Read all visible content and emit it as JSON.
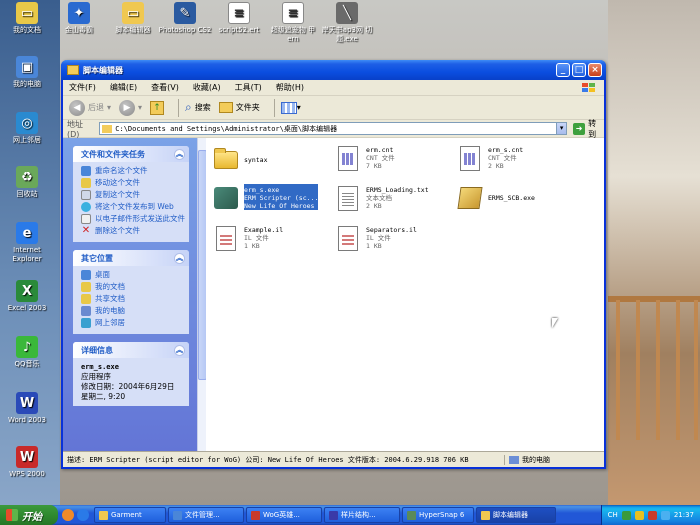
{
  "desktop": {
    "top_icons": [
      {
        "label": "我的文档",
        "color": "#e8c848"
      },
      {
        "label": "金山毒霸",
        "color": "#2a6ad0"
      },
      {
        "label": "脚本编辑器",
        "color": "#f0c850"
      },
      {
        "label": "Photoshop CS2",
        "color": "#2a5aa0"
      },
      {
        "label": "script52.ert",
        "color": "#ffffff"
      },
      {
        "label": "超级追宠物 甲 ern",
        "color": "#ffffff"
      },
      {
        "label": "岸天书ap3网 切题.exe",
        "color": "#6a6a6a"
      }
    ],
    "left_icons": [
      {
        "label": "我的电脑",
        "color": "#4a86d8"
      },
      {
        "label": "网上邻居",
        "color": "#2a8ad0"
      },
      {
        "label": "回收站",
        "color": "#6aa85a"
      },
      {
        "label": "Internet Explorer",
        "color": "#2a7ae8"
      },
      {
        "label": "Excel 2003",
        "color": "#2a8a3a"
      },
      {
        "label": "QQ音乐",
        "color": "#3ab83a"
      },
      {
        "label": "Word 2003",
        "color": "#2a4ab8"
      },
      {
        "label": "WPS 2000",
        "color": "#c82a2a"
      }
    ]
  },
  "window": {
    "title": "脚本编辑器",
    "menu": [
      "文件(F)",
      "编辑(E)",
      "查看(V)",
      "收藏(A)",
      "工具(T)",
      "帮助(H)"
    ],
    "toolbar": {
      "back": "后退",
      "search": "搜索",
      "folders": "文件夹"
    },
    "address_label": "地址(D)",
    "address_value": "C:\\Documents and Settings\\Administrator\\桌面\\脚本编辑器",
    "go_label": "转到",
    "file_tasks": {
      "title": "文件和文件夹任务",
      "items": [
        "重命名这个文件",
        "移动这个文件",
        "复制这个文件",
        "将这个文件发布到 Web",
        "以电子邮件形式发送此文件",
        "删除这个文件"
      ]
    },
    "other_places": {
      "title": "其它位置",
      "items": [
        "桌面",
        "我的文档",
        "共享文档",
        "我的电脑",
        "网上邻居"
      ]
    },
    "details": {
      "title": "详细信息",
      "name": "erm_s.exe",
      "type": "应用程序",
      "modified_label": "修改日期：",
      "modified_date": "2004年6月29日",
      "modified_time": "星期二, 9:20"
    },
    "files": [
      {
        "name": "syntax",
        "line2": "",
        "line3": "",
        "kind": "folder"
      },
      {
        "name": "erm.cnt",
        "line2": "CNT 文件",
        "line3": "7 KB",
        "kind": "cnt"
      },
      {
        "name": "erm_s.cnt",
        "line2": "CNT 文件",
        "line3": "2 KB",
        "kind": "cnt"
      },
      {
        "name": "erm_s.exe",
        "line2": "ERM Scripter (sc...",
        "line3": "New Life Of Heroes",
        "kind": "exe"
      },
      {
        "name": "ERMS_Loading.txt",
        "line2": "文本文档",
        "line3": "2 KB",
        "kind": "txt"
      },
      {
        "name": "ERMS_SCB.exe",
        "line2": "",
        "line3": "",
        "kind": "scb"
      },
      {
        "name": "Example.il",
        "line2": "IL 文件",
        "line3": "1 KB",
        "kind": "il"
      },
      {
        "name": "Separators.il",
        "line2": "IL 文件",
        "line3": "1 KB",
        "kind": "il"
      }
    ],
    "status_text": "描述: ERM Scripter (script editor for WoG) 公司: New Life Of Heroes 文件版本: 2004.6.29.918 706 KB",
    "status_zone": "我的电脑"
  },
  "taskbar": {
    "start": "开始",
    "tasks": [
      {
        "label": "Garment",
        "color": "#f0c850"
      },
      {
        "label": "文件管理...",
        "color": "#4a86d8"
      },
      {
        "label": "WoG英雄...",
        "color": "#c83a2a"
      },
      {
        "label": "样片结构...",
        "color": "#3a3aa8"
      },
      {
        "label": "HyperSnap 6",
        "color": "#5a8a5a"
      },
      {
        "label": "脚本编辑器",
        "color": "#f0c850"
      }
    ],
    "lang": "CH",
    "time": "21:37"
  },
  "colors": {
    "selection": "#316ac5",
    "link": "#215dc6",
    "titlebar": "#0a4ee0"
  }
}
